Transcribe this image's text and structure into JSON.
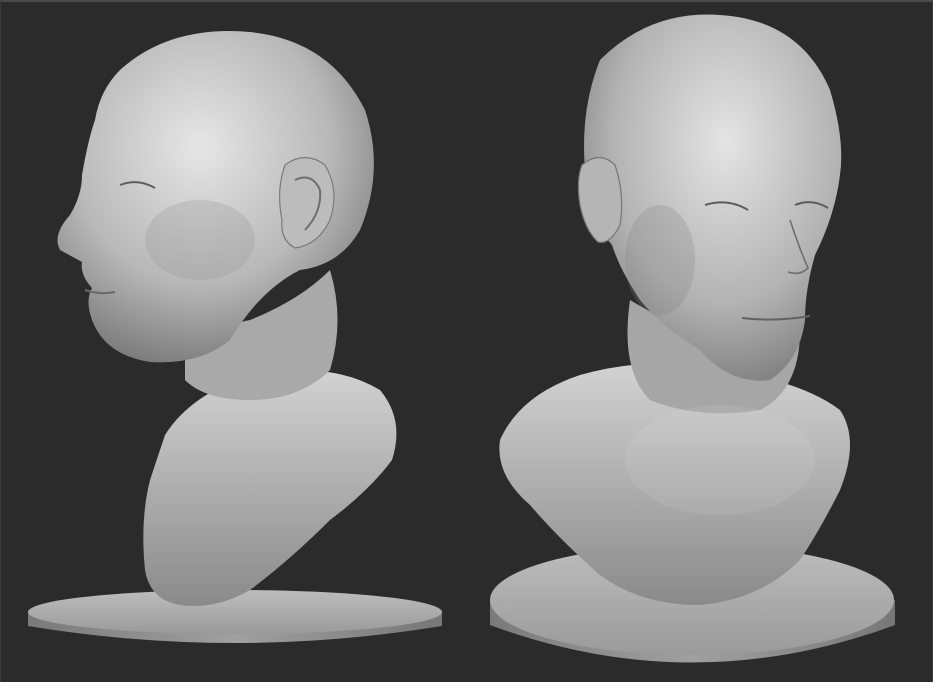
{
  "viewport": {
    "description_label": "",
    "background_color": "#2b2b2b",
    "clay_color": "#b9b9b9",
    "shadow_color": "#5a5a5a",
    "highlight_color": "#e8e8e8"
  },
  "models": [
    {
      "id": "bust-side",
      "view": "left-profile"
    },
    {
      "id": "bust-three-quarter",
      "view": "front-three-quarter"
    }
  ]
}
